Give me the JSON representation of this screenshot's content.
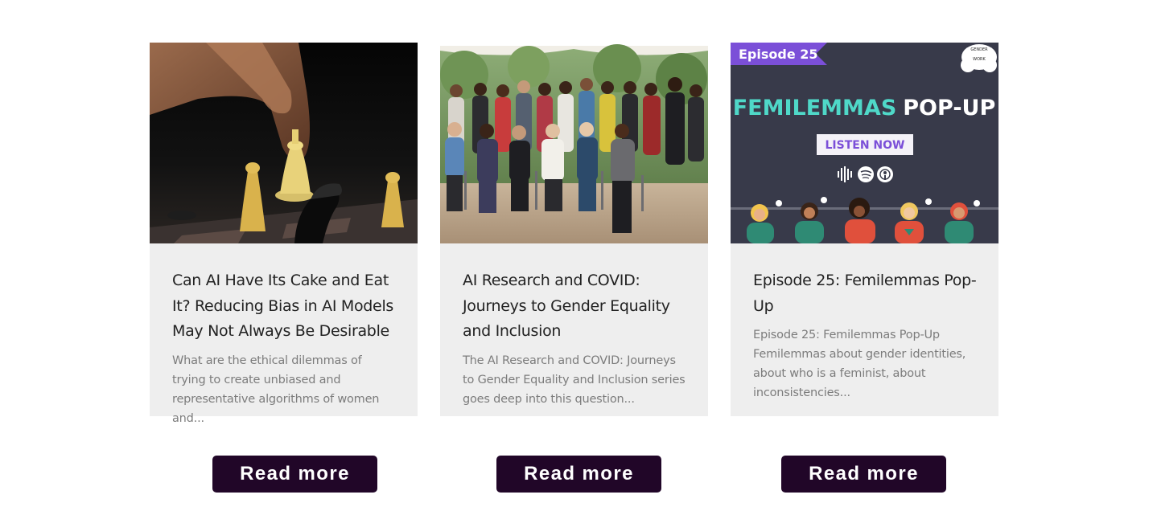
{
  "cards": [
    {
      "title": "Can AI Have Its Cake and Eat It? Reducing Bias in AI Models May Not Always Be Desirable",
      "excerpt": "What are the ethical dilemmas of trying to create unbiased and representative algorithms of women and...",
      "button_label": "Read more"
    },
    {
      "title": "AI Research and COVID: Journeys to Gender Equality and Inclusion",
      "excerpt": "The AI Research and COVID: Journeys to Gender Equality and Inclusion series goes deep into this question...",
      "button_label": "Read more"
    },
    {
      "title": "Episode 25: Femilemmas Pop-Up",
      "excerpt": "Episode 25: Femilemmas Pop-Up Femilemmas about gender identities, about who is a feminist, about inconsistencies...",
      "button_label": "Read more",
      "graphic": {
        "badge": "Episode 25",
        "logo_lines": [
          "GENDER",
          "WORK"
        ],
        "headline_accent": "FEMILEMMAS",
        "headline_rest": "POP-UP",
        "cta": "LISTEN NOW",
        "platform_icons": [
          "podcast-waveform-icon",
          "spotify-icon",
          "apple-podcasts-icon"
        ]
      }
    }
  ],
  "colors": {
    "card_bg": "#eeeeee",
    "button_bg": "#210628",
    "graphic_bg": "#383a4a",
    "graphic_accent": "#4fd8c8",
    "badge_bg": "#7b4fd8"
  }
}
